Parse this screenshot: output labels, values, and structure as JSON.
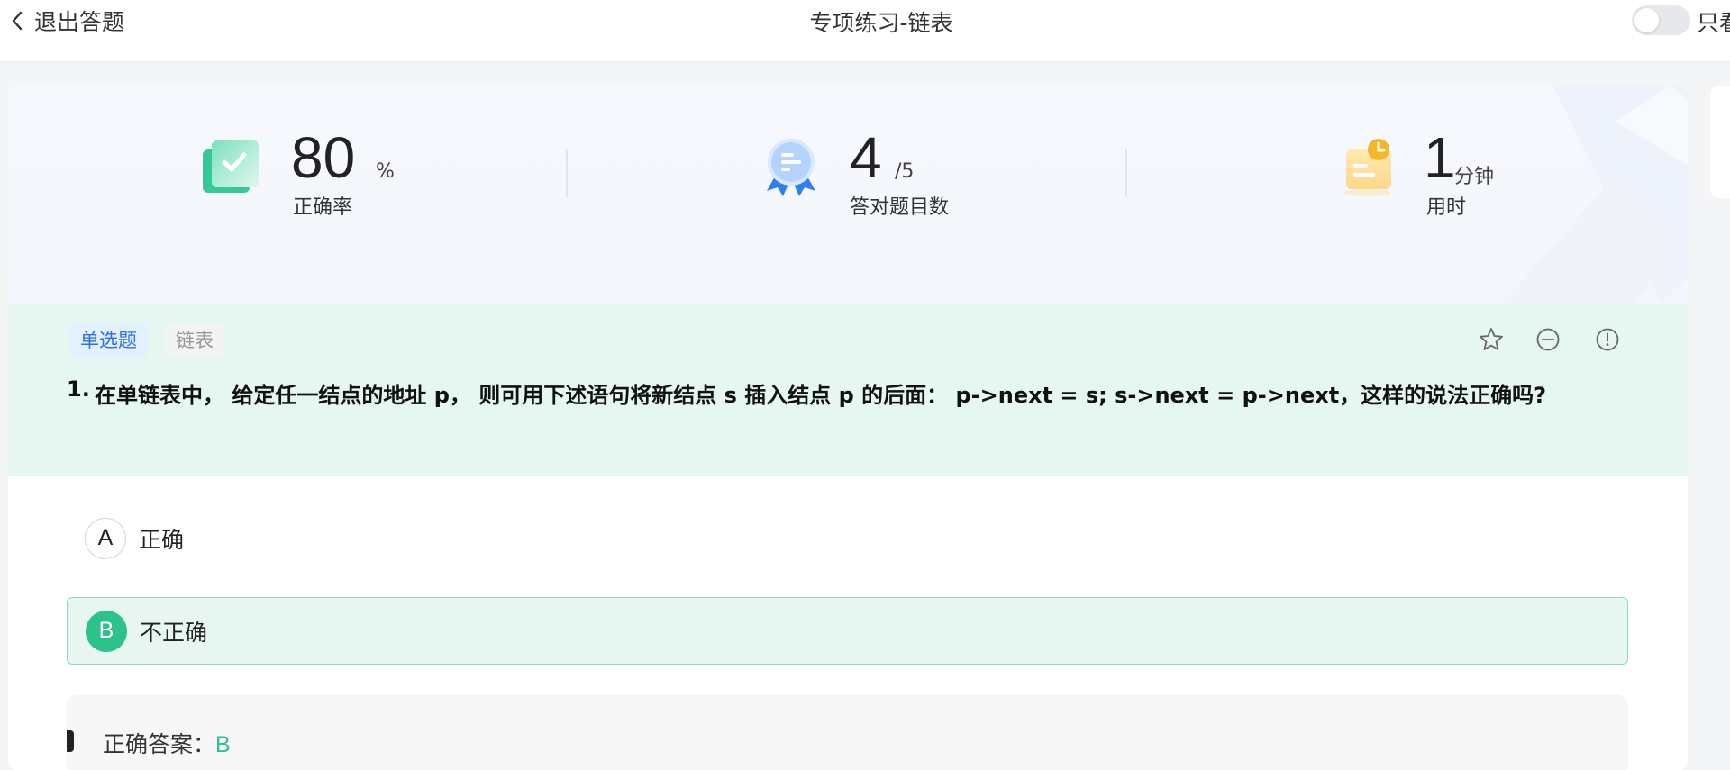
{
  "header": {
    "exit_label": "退出答题",
    "title": "专项练习-链表",
    "toggle_label": "只看",
    "toggle_on": false
  },
  "stats": {
    "accuracy": {
      "value": "80",
      "unit": "%",
      "caption": "正确率"
    },
    "correct": {
      "value": "4",
      "unit": "/5",
      "caption": "答对题目数"
    },
    "time": {
      "value": "1",
      "unit": "分钟",
      "caption": "用时"
    }
  },
  "question": {
    "type_tag": "单选题",
    "topic_tag": "链表",
    "number": "1.",
    "text": "在单链表中， 给定任一结点的地址 p， 则可用下述语句将新结点 s 插入结点 p 的后面： p->next = s; s->next = p->next，这样的说法正确吗?",
    "icons": [
      "star-icon",
      "minus-circle-icon",
      "exclamation-circle-icon"
    ]
  },
  "options": [
    {
      "letter": "A",
      "text": "正确",
      "selected": false
    },
    {
      "letter": "B",
      "text": "不正确",
      "selected": true
    }
  ],
  "answer": {
    "label": "正确答案：",
    "value": "B"
  },
  "colors": {
    "accent_green": "#2ec28b",
    "question_band": "#e6f6f1",
    "type_tag_blue": "#2a72e0"
  }
}
